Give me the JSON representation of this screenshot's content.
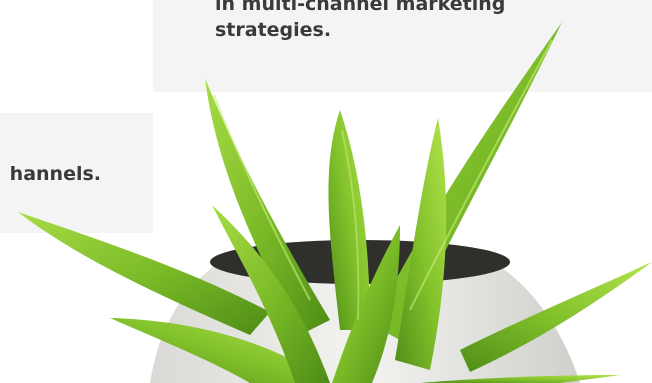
{
  "cards": {
    "top": {
      "line1": "in multi-channel marketing",
      "line2": "strategies."
    },
    "left": {
      "text": "hannels."
    }
  },
  "image": {
    "subject": "potted-aloe-plant",
    "colors": {
      "leaf_light": "#9cd23a",
      "leaf_mid": "#6fae1f",
      "leaf_dark": "#3f7a12",
      "pot": "#e9e9e6",
      "soil": "#2f2f2b",
      "card_bg": "#f4f4f4",
      "text": "#3a3a3a"
    }
  }
}
